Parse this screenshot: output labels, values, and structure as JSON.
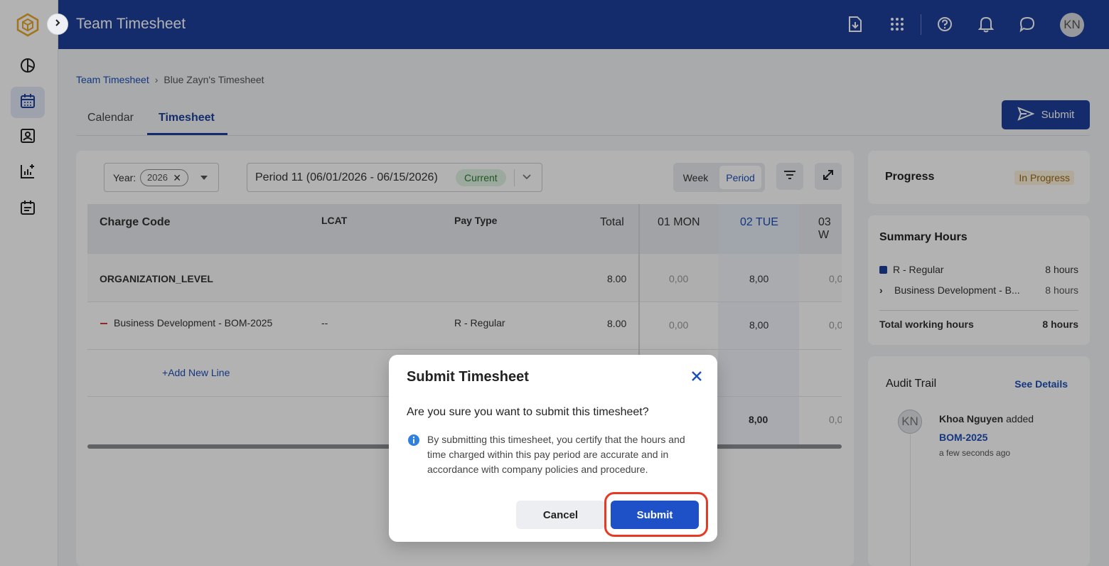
{
  "header": {
    "title": "Team Timesheet",
    "avatar": "KN"
  },
  "breadcrumb": {
    "root": "Team Timesheet",
    "current": "Blue Zayn's Timesheet"
  },
  "tabs": [
    {
      "label": "Calendar"
    },
    {
      "label": "Timesheet",
      "active": true
    }
  ],
  "toolbar": {
    "submit_label": "Submit",
    "year_label": "Year:",
    "year_value": "2026",
    "period_text": "Period 11 (06/01/2026 - 06/15/2026)",
    "period_badge": "Current",
    "view_week": "Week",
    "view_period": "Period"
  },
  "table": {
    "headers": {
      "charge_code": "Charge Code",
      "lcat": "LCAT",
      "pay_type": "Pay Type",
      "total": "Total",
      "day1": "01 MON",
      "day2": "02 TUE",
      "day3": "03 W"
    },
    "org_row": {
      "name": "ORGANIZATION_LEVEL",
      "total": "8.00",
      "d1": "0,00",
      "d2": "8,00",
      "d3": "0,0"
    },
    "line_row": {
      "name": "Business Development - BOM-2025",
      "lcat": "--",
      "pay_type": "R - Regular",
      "total": "8.00",
      "d1": "0,00",
      "d2": "8,00",
      "d3": "0,0"
    },
    "add_line": "Add New Line",
    "footer": {
      "d2": "8,00",
      "d3": "0,0"
    }
  },
  "progress": {
    "title": "Progress",
    "status": "In Progress"
  },
  "summary": {
    "title": "Summary Hours",
    "rows": [
      {
        "label": "R - Regular",
        "value": "8 hours"
      },
      {
        "label": "Business Development - B...",
        "value": "8 hours"
      }
    ],
    "total_label": "Total working hours",
    "total_value": "8 hours"
  },
  "audit": {
    "title": "Audit Trail",
    "link": "See Details",
    "avatar": "KN",
    "user": "Khoa Nguyen",
    "action": " added",
    "item": "BOM-2025",
    "time": "a few seconds ago"
  },
  "modal": {
    "title": "Submit Timesheet",
    "question": "Are you sure you want to submit this timesheet?",
    "info": "By submitting this timesheet, you certify that the hours and time charged within this pay period are accurate and in accordance with company policies and procedure.",
    "cancel_label": "Cancel",
    "submit_label": "Submit"
  },
  "colors": {
    "brand": "#1d3f9a",
    "accent": "#1e50c8",
    "highlight": "#e53b24"
  }
}
